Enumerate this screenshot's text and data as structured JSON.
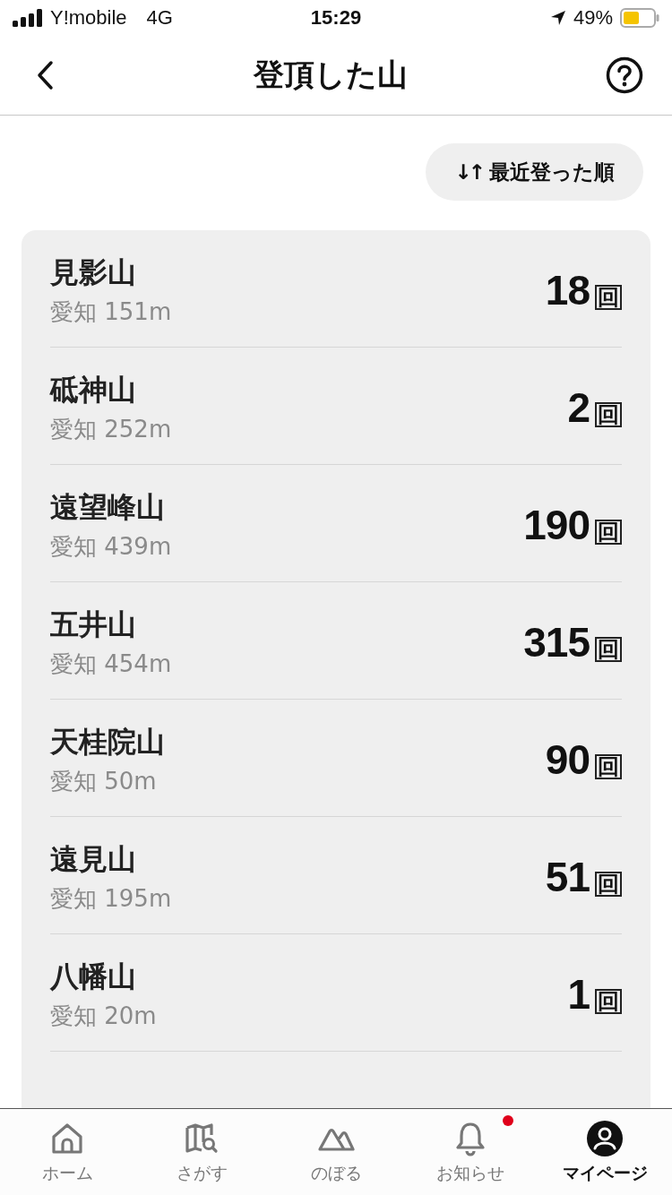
{
  "status_bar": {
    "carrier": "Y!mobile",
    "network": "4G",
    "time": "15:29",
    "battery": "49%"
  },
  "header": {
    "title": "登頂した山"
  },
  "sort_button": {
    "icon": "↓↑",
    "label": "最近登った順"
  },
  "mountains": [
    {
      "name": "見影山",
      "subtitle": "愛知 151m",
      "count": "18",
      "unit": "回"
    },
    {
      "name": "砥神山",
      "subtitle": "愛知 252m",
      "count": "2",
      "unit": "回"
    },
    {
      "name": "遠望峰山",
      "subtitle": "愛知 439m",
      "count": "190",
      "unit": "回"
    },
    {
      "name": "五井山",
      "subtitle": "愛知 454m",
      "count": "315",
      "unit": "回"
    },
    {
      "name": "天桂院山",
      "subtitle": "愛知 50m",
      "count": "90",
      "unit": "回"
    },
    {
      "name": "遠見山",
      "subtitle": "愛知 195m",
      "count": "51",
      "unit": "回"
    },
    {
      "name": "八幡山",
      "subtitle": "愛知 20m",
      "count": "1",
      "unit": "回"
    }
  ],
  "tab_bar": [
    {
      "kind": "home",
      "label": "ホーム",
      "selected": false,
      "badge": false
    },
    {
      "kind": "map",
      "label": "さがす",
      "selected": false,
      "badge": false
    },
    {
      "kind": "climb",
      "label": "のぼる",
      "selected": false,
      "badge": false
    },
    {
      "kind": "bell",
      "label": "お知らせ",
      "selected": false,
      "badge": true
    },
    {
      "kind": "user",
      "label": "マイページ",
      "selected": true,
      "badge": false
    }
  ]
}
